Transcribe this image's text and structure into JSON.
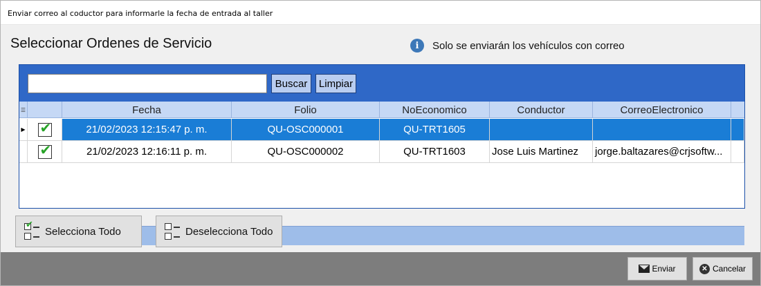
{
  "window": {
    "title": "Enviar correo al coductor para informarle la fecha de entrada al taller"
  },
  "main": {
    "heading": "Seleccionar Ordenes de Servicio",
    "info_text": "Solo se enviarán los vehículos con correo",
    "info_icon": "info-icon"
  },
  "search": {
    "value": "",
    "buscar_label": "Buscar",
    "limpiar_label": "Limpiar"
  },
  "table": {
    "columns": [
      "Fecha",
      "Folio",
      "NoEconomico",
      "Conductor",
      "CorreoElectronico"
    ],
    "rows": [
      {
        "checked": true,
        "selected": true,
        "fecha": "21/02/2023 12:15:47 p. m.",
        "folio": "QU-OSC000001",
        "noeconomico": "QU-TRT1605",
        "conductor": "",
        "correo": ""
      },
      {
        "checked": true,
        "selected": false,
        "fecha": "21/02/2023 12:16:11 p. m.",
        "folio": "QU-OSC000002",
        "noeconomico": "QU-TRT1603",
        "conductor": "Jose Luis Martinez",
        "correo": "jorge.baltazares@crjsoftw..."
      }
    ]
  },
  "actions": {
    "select_all": "Selecciona Todo",
    "deselect_all": "Deselecciona Todo"
  },
  "footer": {
    "send": "Enviar",
    "cancel": "Cancelar"
  },
  "colors": {
    "panel_blue": "#2f68c7",
    "selection_blue": "#1a7dd6",
    "header_blue": "#c5d8f5",
    "check_green": "#27a327"
  }
}
